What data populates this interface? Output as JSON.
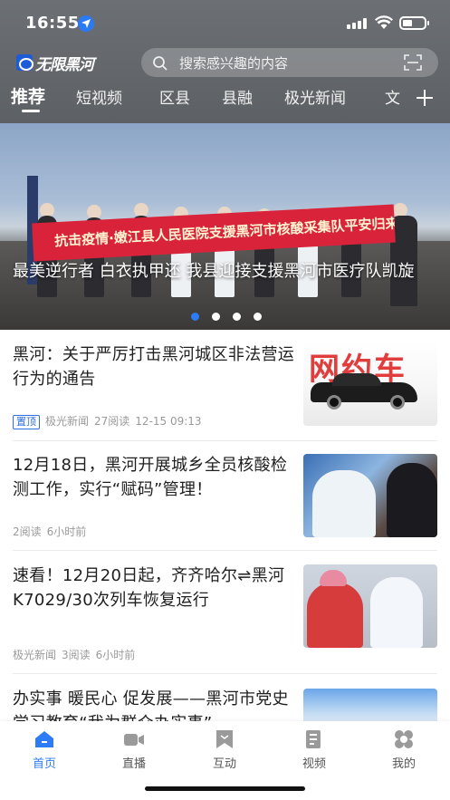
{
  "status": {
    "time": "16:55"
  },
  "app": {
    "logo_text": "无限黑河"
  },
  "search": {
    "placeholder": "搜索感兴趣的内容"
  },
  "tabs": [
    {
      "label": "推荐",
      "active": true
    },
    {
      "label": "短视频"
    },
    {
      "label": "区县"
    },
    {
      "label": "县融"
    },
    {
      "label": "极光新闻"
    },
    {
      "label": "文"
    }
  ],
  "hero": {
    "banner_text": "抗击疫情·嫩江县人民医院支援黑河市核酸采集队平安归来！",
    "caption": "最美逆行者 白衣执甲还 我县迎接支援黑河市医疗队凯旋",
    "dots": 4,
    "active_dot": 0
  },
  "news": [
    {
      "title": "黑河：关于严厉打击黑河城区非法营运行为的通告",
      "pinned_label": "置顶",
      "source": "极光新闻",
      "reads": "27阅读",
      "time": "12-15 09:13",
      "thumb_text": "网约车"
    },
    {
      "title": "12月18日，黑河开展城乡全员核酸检测工作，实行“赋码”管理！",
      "reads": "2阅读",
      "time": "6小时前"
    },
    {
      "title": "速看！12月20日起，齐齐哈尔⇌黑河 K7029/30次列车恢复运行",
      "source": "极光新闻",
      "reads": "3阅读",
      "time": "6小时前"
    },
    {
      "title": "办实事 暖民心 促发展——黑河市党史学习教育“我为群众办实事”"
    }
  ],
  "bottom_nav": [
    {
      "label": "首页",
      "icon": "home-icon",
      "active": true
    },
    {
      "label": "直播",
      "icon": "video-camera-icon"
    },
    {
      "label": "互动",
      "icon": "bookmark-flag-icon"
    },
    {
      "label": "视频",
      "icon": "document-video-icon"
    },
    {
      "label": "我的",
      "icon": "profile-icon"
    }
  ],
  "colors": {
    "accent": "#2d7cf6",
    "header_bg": "#65686d",
    "pin": "#2d6fe0"
  }
}
